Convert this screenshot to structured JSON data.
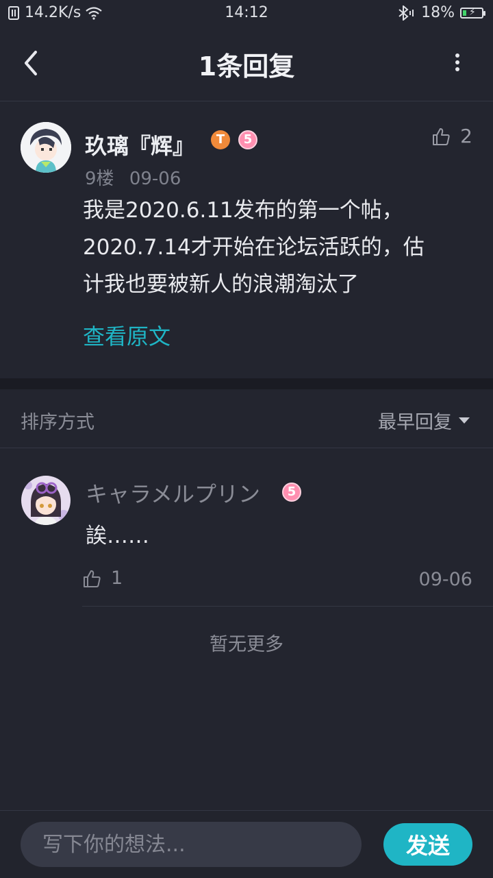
{
  "status_bar": {
    "net_speed": "14.2K/s",
    "time": "14:12",
    "battery": "18%",
    "battery_level": 0.18
  },
  "header": {
    "title": "1条回复"
  },
  "main_post": {
    "author": "玖璃『辉』",
    "badges": [
      "T",
      "5"
    ],
    "likes": "2",
    "floor": "9楼",
    "date": "09-06",
    "content_lines": [
      "我是2020.6.11发布的第一个帖，",
      "2020.7.14才开始在论坛活跃的，估",
      "计我也要被新人的浪潮淘汰了"
    ],
    "view_original": "查看原文"
  },
  "sort": {
    "label": "排序方式",
    "value": "最早回复"
  },
  "replies": [
    {
      "author": "キャラメルプリン",
      "badge": "5",
      "content": "誒……",
      "likes": "1",
      "date": "09-06"
    }
  ],
  "no_more": "暂无更多",
  "composer": {
    "placeholder": "写下你的想法...",
    "send_label": "发送"
  },
  "colors": {
    "background": "#23252f",
    "accent": "#1fb5c5",
    "secondary_text": "#8a8c96"
  }
}
